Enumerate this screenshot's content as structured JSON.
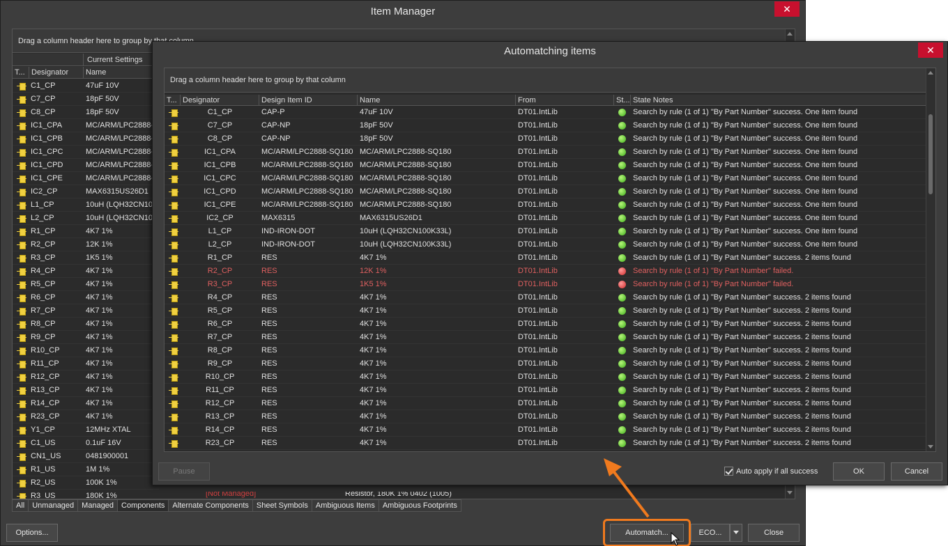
{
  "item_manager": {
    "title": "Item Manager",
    "close_label": "✕",
    "group_hint": "Drag a column header here to group by that column",
    "band": "Current Settings",
    "columns": [
      "T...",
      "Designator",
      "Name"
    ],
    "rows": [
      {
        "designator": "C1_CP",
        "name": "47uF 10V"
      },
      {
        "designator": "C7_CP",
        "name": "18pF 50V"
      },
      {
        "designator": "C8_CP",
        "name": "18pF 50V"
      },
      {
        "designator": "IC1_CPA",
        "name": "MC/ARM/LPC2888-"
      },
      {
        "designator": "IC1_CPB",
        "name": "MC/ARM/LPC2888-"
      },
      {
        "designator": "IC1_CPC",
        "name": "MC/ARM/LPC2888-"
      },
      {
        "designator": "IC1_CPD",
        "name": "MC/ARM/LPC2888-"
      },
      {
        "designator": "IC1_CPE",
        "name": "MC/ARM/LPC2888-"
      },
      {
        "designator": "IC2_CP",
        "name": "MAX6315US26D1"
      },
      {
        "designator": "L1_CP",
        "name": "10uH (LQH32CN100"
      },
      {
        "designator": "L2_CP",
        "name": "10uH (LQH32CN100"
      },
      {
        "designator": "R1_CP",
        "name": "4K7 1%"
      },
      {
        "designator": "R2_CP",
        "name": "12K 1%"
      },
      {
        "designator": "R3_CP",
        "name": "1K5 1%"
      },
      {
        "designator": "R4_CP",
        "name": "4K7 1%"
      },
      {
        "designator": "R5_CP",
        "name": "4K7 1%"
      },
      {
        "designator": "R6_CP",
        "name": "4K7 1%"
      },
      {
        "designator": "R7_CP",
        "name": "4K7 1%"
      },
      {
        "designator": "R8_CP",
        "name": "4K7 1%"
      },
      {
        "designator": "R9_CP",
        "name": "4K7 1%"
      },
      {
        "designator": "R10_CP",
        "name": "4K7 1%"
      },
      {
        "designator": "R11_CP",
        "name": "4K7 1%"
      },
      {
        "designator": "R12_CP",
        "name": "4K7 1%"
      },
      {
        "designator": "R13_CP",
        "name": "4K7 1%"
      },
      {
        "designator": "R14_CP",
        "name": "4K7 1%"
      },
      {
        "designator": "R23_CP",
        "name": "4K7 1%"
      },
      {
        "designator": "Y1_CP",
        "name": "12MHz XTAL"
      },
      {
        "designator": "C1_US",
        "name": "0.1uF 16V"
      },
      {
        "designator": "CN1_US",
        "name": "0481900001"
      },
      {
        "designator": "R1_US",
        "name": "1M 1%"
      },
      {
        "designator": "R2_US",
        "name": "100K 1%"
      },
      {
        "designator": "R3_US",
        "name": "180K 1%"
      }
    ],
    "partial_row": {
      "status": "[Not Managed]",
      "description": "Resistor, 180K 1% 0402 (1005)"
    },
    "tabs": [
      "All",
      "Unmanaged",
      "Managed",
      "Components",
      "Alternate Components",
      "Sheet Symbols",
      "Ambiguous Items",
      "Ambiguous Footprints"
    ],
    "active_tab": "Components",
    "buttons": {
      "options": "Options...",
      "automatch": "Automatch...",
      "eco": "ECO...",
      "close": "Close"
    }
  },
  "automatching": {
    "title": "Automatching items",
    "close_label": "✕",
    "group_hint": "Drag a column header here to group by that column",
    "columns": [
      "T...",
      "Designator",
      "Design Item ID",
      "Name",
      "From",
      "St...",
      "State Notes"
    ],
    "rows": [
      {
        "designator": "C1_CP",
        "item_id": "CAP-P",
        "name": "47uF 10V",
        "from": "DT01.IntLib",
        "status": "ok",
        "notes": "Search by rule (1 of 1) \"By Part Number\" success. One item found"
      },
      {
        "designator": "C7_CP",
        "item_id": "CAP-NP",
        "name": "18pF 50V",
        "from": "DT01.IntLib",
        "status": "ok",
        "notes": "Search by rule (1 of 1) \"By Part Number\" success. One item found"
      },
      {
        "designator": "C8_CP",
        "item_id": "CAP-NP",
        "name": "18pF 50V",
        "from": "DT01.IntLib",
        "status": "ok",
        "notes": "Search by rule (1 of 1) \"By Part Number\" success. One item found"
      },
      {
        "designator": "IC1_CPA",
        "item_id": "MC/ARM/LPC2888-SQ180",
        "name": "MC/ARM/LPC2888-SQ180",
        "from": "DT01.IntLib",
        "status": "ok",
        "notes": "Search by rule (1 of 1) \"By Part Number\" success. One item found"
      },
      {
        "designator": "IC1_CPB",
        "item_id": "MC/ARM/LPC2888-SQ180",
        "name": "MC/ARM/LPC2888-SQ180",
        "from": "DT01.IntLib",
        "status": "ok",
        "notes": "Search by rule (1 of 1) \"By Part Number\" success. One item found"
      },
      {
        "designator": "IC1_CPC",
        "item_id": "MC/ARM/LPC2888-SQ180",
        "name": "MC/ARM/LPC2888-SQ180",
        "from": "DT01.IntLib",
        "status": "ok",
        "notes": "Search by rule (1 of 1) \"By Part Number\" success. One item found"
      },
      {
        "designator": "IC1_CPD",
        "item_id": "MC/ARM/LPC2888-SQ180",
        "name": "MC/ARM/LPC2888-SQ180",
        "from": "DT01.IntLib",
        "status": "ok",
        "notes": "Search by rule (1 of 1) \"By Part Number\" success. One item found"
      },
      {
        "designator": "IC1_CPE",
        "item_id": "MC/ARM/LPC2888-SQ180",
        "name": "MC/ARM/LPC2888-SQ180",
        "from": "DT01.IntLib",
        "status": "ok",
        "notes": "Search by rule (1 of 1) \"By Part Number\" success. One item found"
      },
      {
        "designator": "IC2_CP",
        "item_id": "MAX6315",
        "name": "MAX6315US26D1",
        "from": "DT01.IntLib",
        "status": "ok",
        "notes": "Search by rule (1 of 1) \"By Part Number\" success. One item found"
      },
      {
        "designator": "L1_CP",
        "item_id": "IND-IRON-DOT",
        "name": "10uH (LQH32CN100K33L)",
        "from": "DT01.IntLib",
        "status": "ok",
        "notes": "Search by rule (1 of 1) \"By Part Number\" success. One item found"
      },
      {
        "designator": "L2_CP",
        "item_id": "IND-IRON-DOT",
        "name": "10uH (LQH32CN100K33L)",
        "from": "DT01.IntLib",
        "status": "ok",
        "notes": "Search by rule (1 of 1) \"By Part Number\" success. One item found"
      },
      {
        "designator": "R1_CP",
        "item_id": "RES",
        "name": "4K7 1%",
        "from": "DT01.IntLib",
        "status": "ok",
        "notes": "Search by rule (1 of 1) \"By Part Number\" success. 2 items found"
      },
      {
        "designator": "R2_CP",
        "item_id": "RES",
        "name": "12K 1%",
        "from": "DT01.IntLib",
        "status": "fail",
        "notes": "Search by rule (1 of 1) \"By Part Number\" failed."
      },
      {
        "designator": "R3_CP",
        "item_id": "RES",
        "name": "1K5 1%",
        "from": "DT01.IntLib",
        "status": "fail",
        "notes": "Search by rule (1 of 1) \"By Part Number\" failed."
      },
      {
        "designator": "R4_CP",
        "item_id": "RES",
        "name": "4K7 1%",
        "from": "DT01.IntLib",
        "status": "ok",
        "notes": "Search by rule (1 of 1) \"By Part Number\" success. 2 items found"
      },
      {
        "designator": "R5_CP",
        "item_id": "RES",
        "name": "4K7 1%",
        "from": "DT01.IntLib",
        "status": "ok",
        "notes": "Search by rule (1 of 1) \"By Part Number\" success. 2 items found"
      },
      {
        "designator": "R6_CP",
        "item_id": "RES",
        "name": "4K7 1%",
        "from": "DT01.IntLib",
        "status": "ok",
        "notes": "Search by rule (1 of 1) \"By Part Number\" success. 2 items found"
      },
      {
        "designator": "R7_CP",
        "item_id": "RES",
        "name": "4K7 1%",
        "from": "DT01.IntLib",
        "status": "ok",
        "notes": "Search by rule (1 of 1) \"By Part Number\" success. 2 items found"
      },
      {
        "designator": "R8_CP",
        "item_id": "RES",
        "name": "4K7 1%",
        "from": "DT01.IntLib",
        "status": "ok",
        "notes": "Search by rule (1 of 1) \"By Part Number\" success. 2 items found"
      },
      {
        "designator": "R9_CP",
        "item_id": "RES",
        "name": "4K7 1%",
        "from": "DT01.IntLib",
        "status": "ok",
        "notes": "Search by rule (1 of 1) \"By Part Number\" success. 2 items found"
      },
      {
        "designator": "R10_CP",
        "item_id": "RES",
        "name": "4K7 1%",
        "from": "DT01.IntLib",
        "status": "ok",
        "notes": "Search by rule (1 of 1) \"By Part Number\" success. 2 items found"
      },
      {
        "designator": "R11_CP",
        "item_id": "RES",
        "name": "4K7 1%",
        "from": "DT01.IntLib",
        "status": "ok",
        "notes": "Search by rule (1 of 1) \"By Part Number\" success. 2 items found"
      },
      {
        "designator": "R12_CP",
        "item_id": "RES",
        "name": "4K7 1%",
        "from": "DT01.IntLib",
        "status": "ok",
        "notes": "Search by rule (1 of 1) \"By Part Number\" success. 2 items found"
      },
      {
        "designator": "R13_CP",
        "item_id": "RES",
        "name": "4K7 1%",
        "from": "DT01.IntLib",
        "status": "ok",
        "notes": "Search by rule (1 of 1) \"By Part Number\" success. 2 items found"
      },
      {
        "designator": "R14_CP",
        "item_id": "RES",
        "name": "4K7 1%",
        "from": "DT01.IntLib",
        "status": "ok",
        "notes": "Search by rule (1 of 1) \"By Part Number\" success. 2 items found"
      },
      {
        "designator": "R23_CP",
        "item_id": "RES",
        "name": "4K7 1%",
        "from": "DT01.IntLib",
        "status": "ok",
        "notes": "Search by rule (1 of 1) \"By Part Number\" success. 2 items found"
      }
    ],
    "pause_label": "Pause",
    "auto_apply_label": "Auto apply if all success",
    "auto_apply_checked": true,
    "ok_label": "OK",
    "cancel_label": "Cancel"
  },
  "colors": {
    "highlight": "#f07a1e",
    "fail_text": "#e06060",
    "ok_status": "#3fae1c",
    "fail_status": "#d02c2c"
  }
}
